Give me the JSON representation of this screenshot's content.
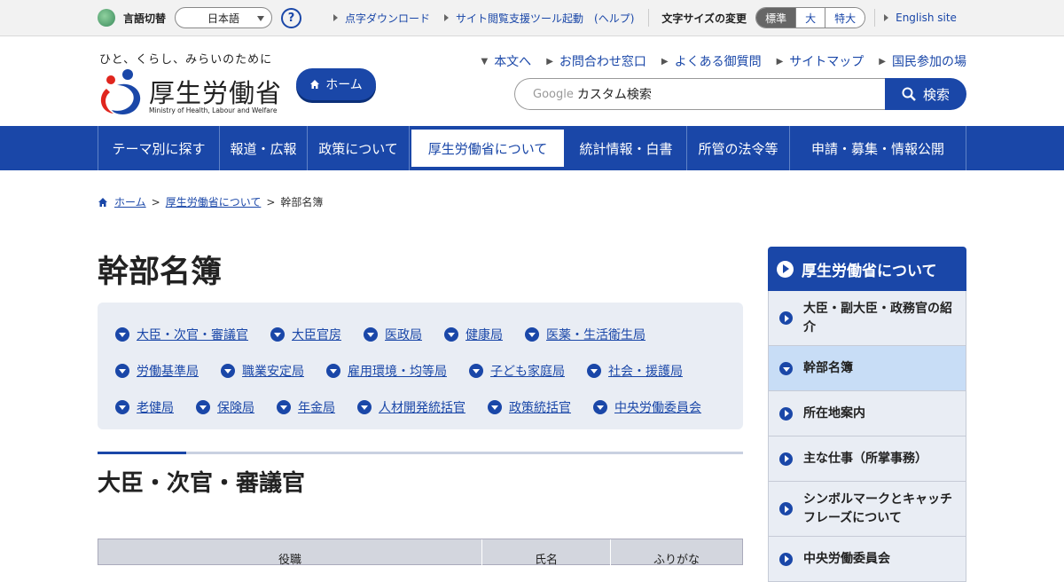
{
  "util": {
    "lang_label": "言語切替",
    "lang_value": "日本語",
    "help": "?",
    "links": [
      "点字ダウンロード",
      "サイト閲覧支援ツール起動　(ヘルプ)"
    ],
    "fontsize_label": "文字サイズの変更",
    "fontsize_options": [
      "標準",
      "大",
      "特大"
    ],
    "english": "English site"
  },
  "header": {
    "tagline": "ひと、くらし、みらいのために",
    "logo_title": "厚生労働省",
    "logo_en": "Ministry of Health, Labour and Welfare",
    "home_label": "ホーム",
    "links": [
      "本文へ",
      "お問合わせ窓口",
      "よくある御質問",
      "サイトマップ",
      "国民参加の場"
    ],
    "search_brand": "Google",
    "search_placeholder": "カスタム検索",
    "search_button": "検索"
  },
  "gnav": [
    "テーマ別に探す",
    "報道・広報",
    "政策について",
    "厚生労働省について",
    "統計情報・白書",
    "所管の法令等",
    "申請・募集・情報公開"
  ],
  "breadcrumb": {
    "home": "ホーム",
    "parent": "厚生労働省について",
    "current": "幹部名簿",
    "sep": ">"
  },
  "main": {
    "title": "幹部名簿",
    "anchors": [
      [
        "大臣・次官・審議官",
        "大臣官房",
        "医政局",
        "健康局",
        "医薬・生活衛生局"
      ],
      [
        "労働基準局",
        "職業安定局",
        "雇用環境・均等局",
        "子ども家庭局",
        "社会・援護局"
      ],
      [
        "老健局",
        "保険局",
        "年金局",
        "人材開発統括官",
        "政策統括官",
        "中央労働委員会"
      ]
    ],
    "section_title": "大臣・次官・審議官",
    "table_headers": [
      "役職",
      "氏名",
      "ふりがな"
    ]
  },
  "side": {
    "heading": "厚生労働省について",
    "items": [
      "大臣・副大臣・政務官の紹介",
      "幹部名簿",
      "所在地案内",
      "主な仕事（所掌事務）",
      "シンボルマークとキャッチフレーズについて",
      "中央労働委員会"
    ]
  },
  "colors": {
    "brand": "#1a47a8",
    "accent_red": "#e0261e"
  }
}
